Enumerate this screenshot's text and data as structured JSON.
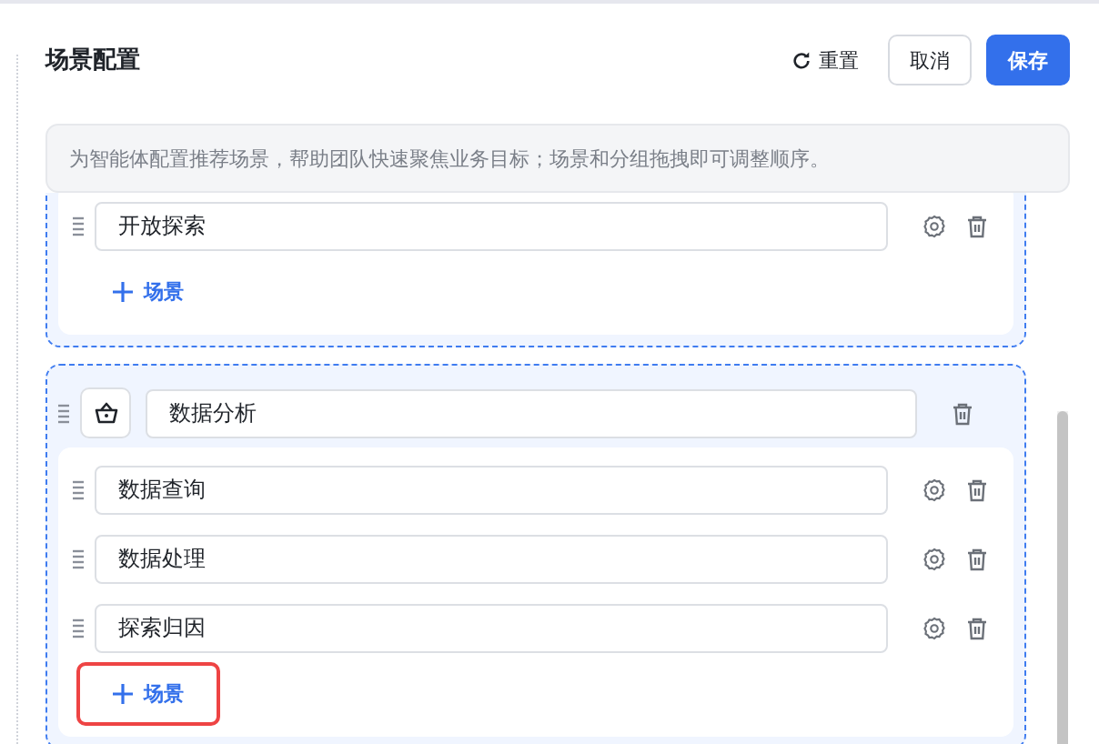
{
  "header": {
    "title": "场景配置",
    "reset": "重置",
    "cancel": "取消",
    "save": "保存"
  },
  "hint": "为智能体配置推荐场景，帮助团队快速聚焦业务目标；场景和分组拖拽即可调整顺序。",
  "groups": [
    {
      "scenes": [
        {
          "name": "开放探索"
        }
      ],
      "add_label": "场景",
      "highlighted": false
    },
    {
      "name": "数据分析",
      "scenes": [
        {
          "name": "数据查询"
        },
        {
          "name": "数据处理"
        },
        {
          "name": "探索归因"
        }
      ],
      "add_label": "场景",
      "highlighted": true
    }
  ]
}
